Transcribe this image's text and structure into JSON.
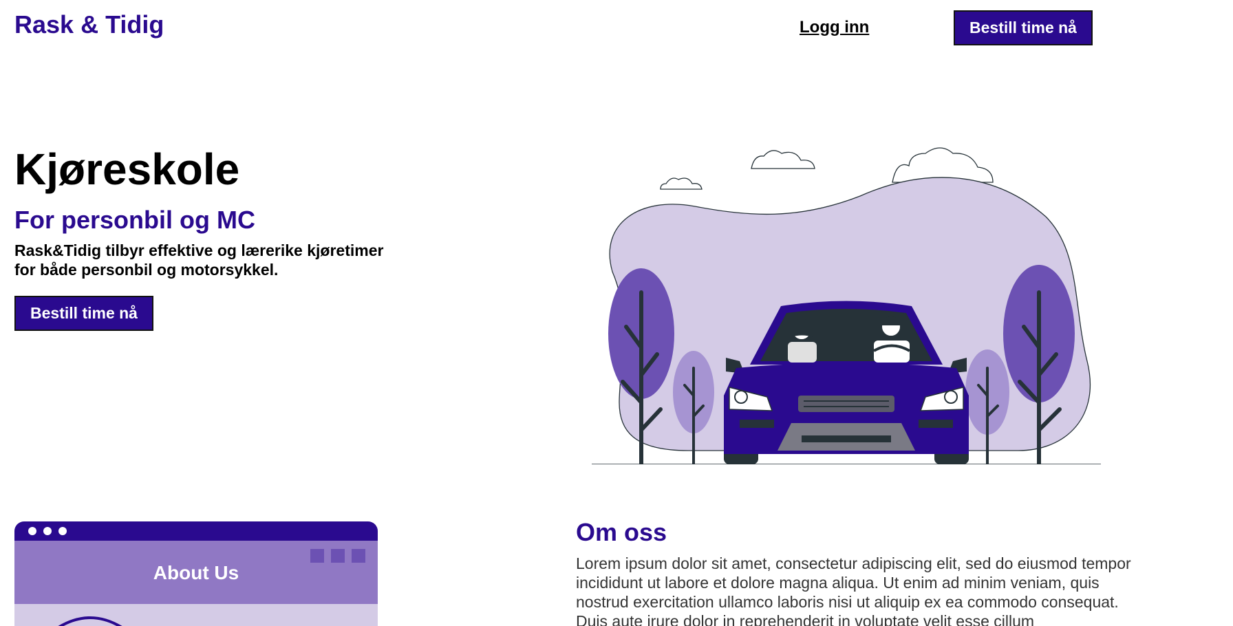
{
  "header": {
    "brand": "Rask & Tidig",
    "login_label": "Logg inn",
    "cta_label": "Bestill time nå"
  },
  "hero": {
    "title": "Kjøreskole",
    "subtitle": "For personbil og MC",
    "description": "Rask&Tidig tilbyr effektive og lærerike kjøretimer for både personbil og motorsykkel.",
    "cta_label": "Bestill time nå",
    "illustration_icon": "car-driving-lesson-illustration"
  },
  "about": {
    "card_label": "About Us",
    "title": "Om oss",
    "text": "Lorem ipsum dolor sit amet, consectetur adipiscing elit, sed do eiusmod tempor incididunt ut labore et dolore magna aliqua. Ut enim ad minim veniam, quis nostrud exercitation ullamco laboris nisi ut aliquip ex ea commodo consequat. Duis aute irure dolor in reprehenderit in voluptate velit esse cillum"
  },
  "colors": {
    "brand": "#2a0a8f",
    "light_purple": "#d4cbe6",
    "mid_purple": "#6c51b3",
    "soft_purple": "#a694d2",
    "dark": "#263238"
  }
}
